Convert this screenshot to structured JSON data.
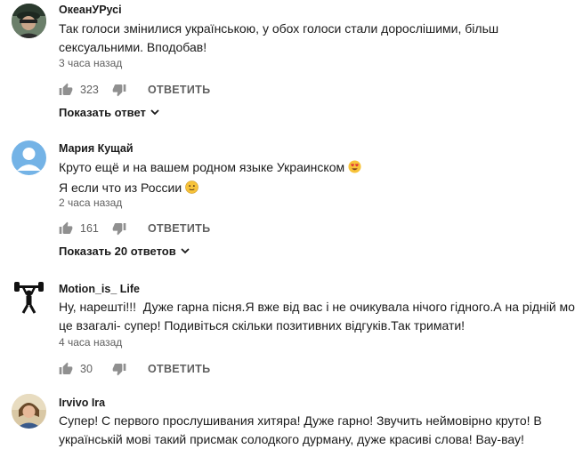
{
  "comments": [
    {
      "author": "ОкеанУРусі",
      "lines": [
        "Так голоси змінилися українською, у обох голоси стали дорослішими, більш",
        "сексуальними. Вподобав!"
      ],
      "time": "3 часа назад",
      "likes": "323",
      "reply_label": "ОТВЕТИТЬ",
      "show_replies": "Показать ответ",
      "avatar": "photo-dark-hat"
    },
    {
      "author": "Мария Кущай",
      "lines": [
        "Круто ещё и на вашем родном языке Украинском",
        "Я если что из России"
      ],
      "emojis": [
        "heart-eyes-emoji",
        "slightly-smiling-emoji"
      ],
      "time": "2 часа назад",
      "likes": "161",
      "reply_label": "ОТВЕТИТЬ",
      "show_replies": "Показать 20 ответов",
      "avatar": "default-user-avatar"
    },
    {
      "author": "Motion_is_ Life",
      "lines": [
        "Ну, нарешті!!!  Дуже гарна пісня.Я вже від вас і не очикувала нічого гідного.А на рідній мові",
        "це взагалі- супер! Подивіться скільки позитивних відгуків.Так тримати!"
      ],
      "time": "4 часа назад",
      "likes": "30",
      "reply_label": "ОТВЕТИТЬ",
      "avatar": "weightlifter-figure"
    },
    {
      "author": "Irvivo Ira",
      "lines": [
        "Супер! С первого прослушивания хитяра! Дуже гарно! Звучить неймовірно круто! В",
        "українській мові такий присмак солодкого дурману, дуже красиві слова! Вау-вау!"
      ],
      "avatar": "photo-woman"
    }
  ],
  "colors": {
    "text": "#1a1a1a",
    "meta": "#606060",
    "default_avatar_bg": "#74b3e6"
  }
}
